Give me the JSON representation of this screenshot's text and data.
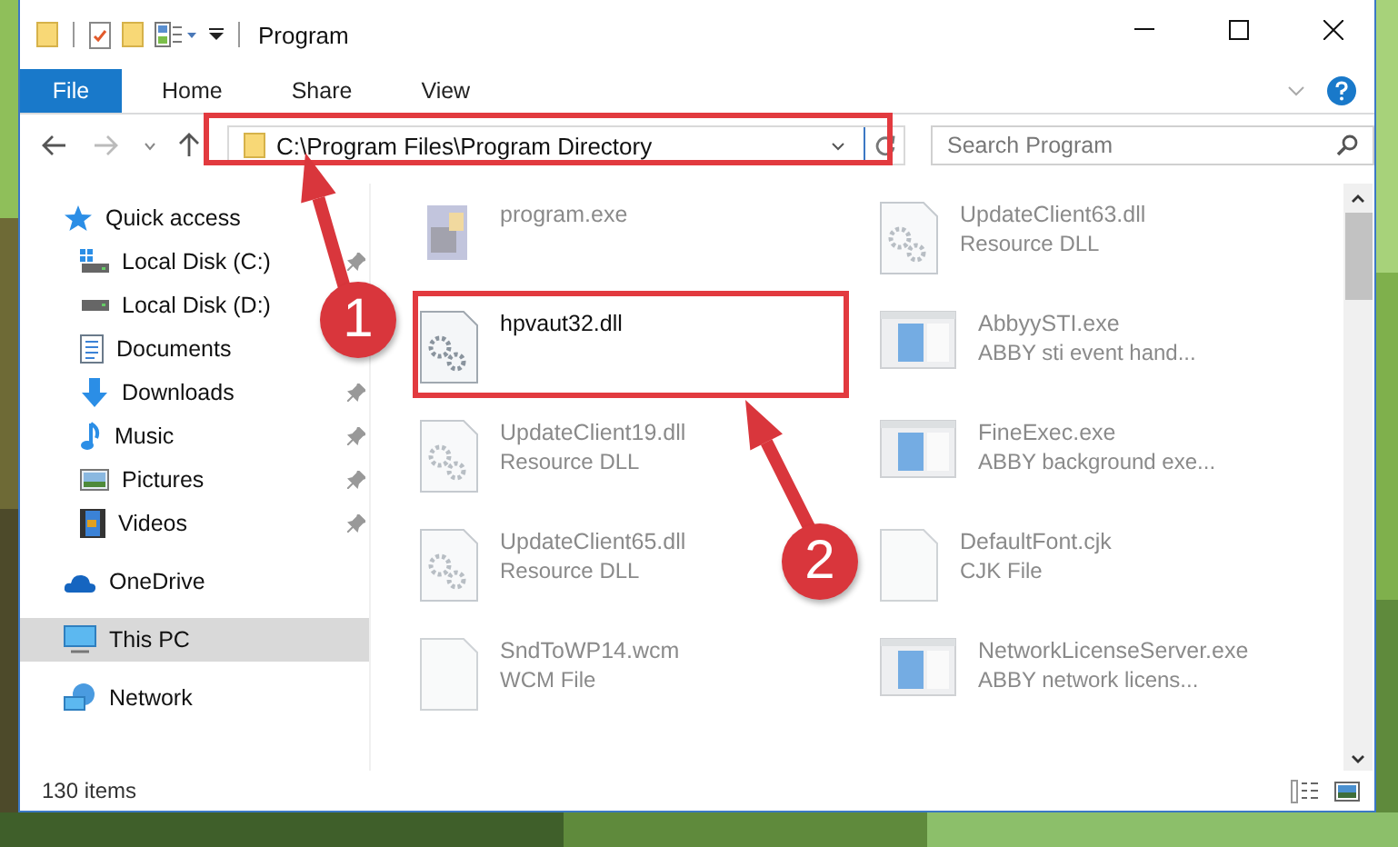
{
  "window": {
    "title": "Program"
  },
  "ribbon_tabs": [
    {
      "label": "File",
      "kind": "file"
    },
    {
      "label": "Home",
      "kind": "tab"
    },
    {
      "label": "Share",
      "kind": "tab"
    },
    {
      "label": "View",
      "kind": "tab"
    }
  ],
  "address": {
    "path": "C:\\Program Files\\Program Directory"
  },
  "search": {
    "placeholder": "Search Program"
  },
  "nav": [
    {
      "label": "Quick access",
      "selected": false,
      "children": [
        {
          "label": "Local Disk (C:)",
          "selected": false,
          "pinned": true
        },
        {
          "label": "Local Disk (D:)",
          "selected": false
        },
        {
          "label": "Documents",
          "selected": false
        },
        {
          "label": "Downloads",
          "selected": false,
          "pinned": true
        },
        {
          "label": "Music",
          "selected": false,
          "pinned": true
        },
        {
          "label": "Pictures",
          "selected": false,
          "pinned": true
        },
        {
          "label": "Videos",
          "selected": false,
          "pinned": true
        }
      ]
    },
    {
      "label": "OneDrive",
      "selected": false
    },
    {
      "label": "This PC",
      "selected": true
    },
    {
      "label": "Network",
      "selected": false
    }
  ],
  "files": [
    {
      "name": "program.exe",
      "kind": "program",
      "faded": true
    },
    {
      "name": "hpvaut32.dll",
      "kind": "dll",
      "faded": false
    },
    {
      "name": "UpdateClient19.dll",
      "type": "Resource DLL",
      "kind": "dll",
      "faded": true
    },
    {
      "name": "UpdateClient65.dll",
      "type": "Resource DLL",
      "kind": "dll",
      "faded": true
    },
    {
      "name": "SndToWP14.wcm",
      "type": "WCM File",
      "kind": "blank",
      "faded": true
    },
    {
      "name": "UpdateClient63.dll",
      "type": "Resource DLL",
      "kind": "dll",
      "faded": true
    },
    {
      "name": "AbbyySTI.exe",
      "type": "ABBY sti event hand...",
      "kind": "exe",
      "faded": true
    },
    {
      "name": "FineExec.exe",
      "type": "ABBY background exe...",
      "kind": "exe",
      "faded": true
    },
    {
      "name": "DefaultFont.cjk",
      "type": "CJK File",
      "kind": "blank",
      "faded": true
    },
    {
      "name": "NetworkLicenseServer.exe",
      "type": "ABBY network licens...",
      "kind": "exe",
      "faded": true
    }
  ],
  "status_bar": {
    "count": "130 items"
  },
  "annotations": [
    {
      "number": "1"
    },
    {
      "number": "2"
    }
  ]
}
